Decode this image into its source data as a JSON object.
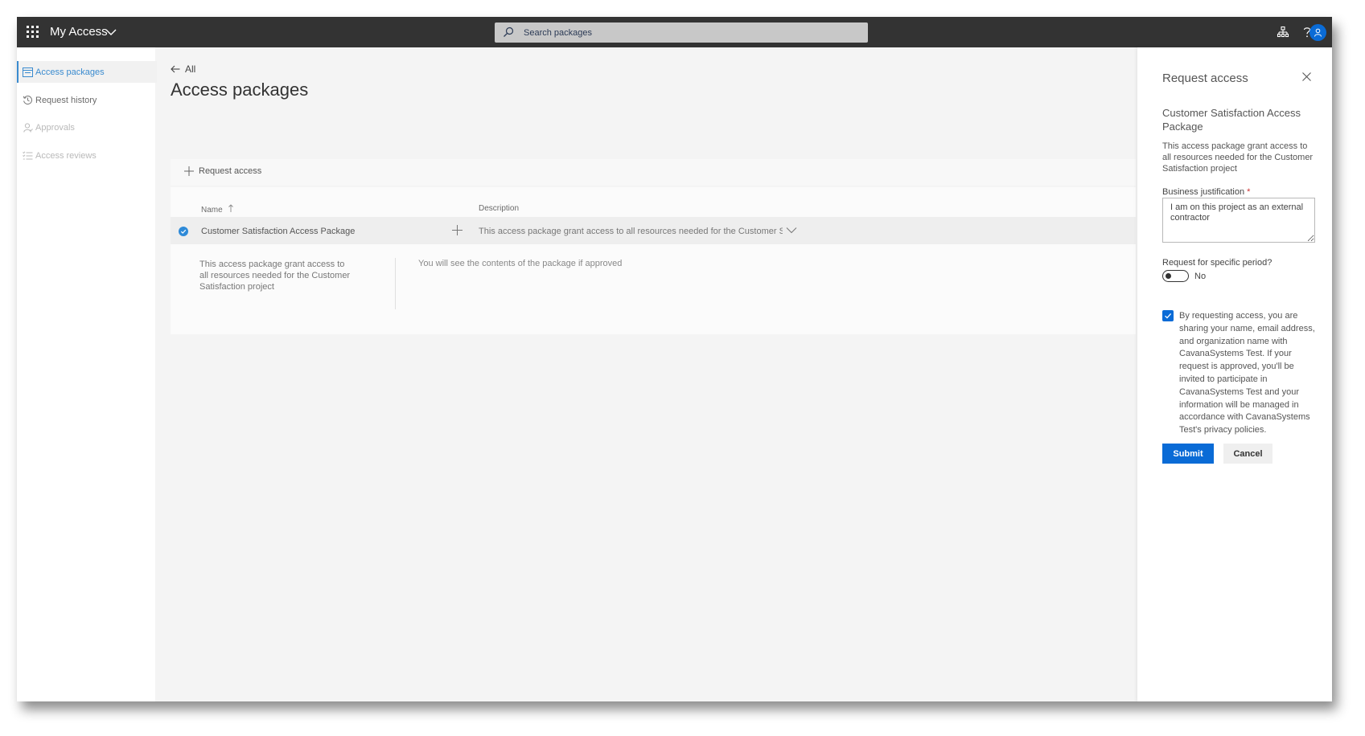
{
  "app": {
    "title": "My Access"
  },
  "search": {
    "placeholder": "Search packages"
  },
  "sidebar": {
    "items": [
      {
        "label": "Access packages",
        "state": "active"
      },
      {
        "label": "Request history",
        "state": "normal"
      },
      {
        "label": "Approvals",
        "state": "disabled"
      },
      {
        "label": "Access reviews",
        "state": "disabled"
      }
    ]
  },
  "main": {
    "back_label": "All",
    "title": "Access packages",
    "command_request": "Request access",
    "columns": {
      "name": "Name",
      "description": "Description"
    },
    "row": {
      "name": "Customer Satisfaction Access Package",
      "description": "This access package grant access to all resources needed for the Customer Satisfac"
    },
    "detail": {
      "description": "This access package grant access to all resources needed for the Customer Satisfaction project",
      "contents_note": "You will see the contents of the package if approved"
    }
  },
  "panel": {
    "title": "Request access",
    "package_name": "Customer Satisfaction Access Package",
    "package_description": "This access package grant access to all resources needed for the Customer Satisfaction project",
    "justification_label": "Business justification",
    "justification_required": "*",
    "justification_value": "I am on this project as an external contractor",
    "period_label": "Request for specific period?",
    "period_value": "No",
    "consent_text": "By requesting access, you are sharing your name, email address, and organization name with CavanaSystems Test. If your request is approved, you'll be invited to participate in CavanaSystems Test and your information will be managed in accordance with CavanaSystems Test's privacy policies.",
    "submit_label": "Submit",
    "cancel_label": "Cancel"
  },
  "colors": {
    "accent": "#0a6bd6",
    "topbar": "#333333"
  }
}
